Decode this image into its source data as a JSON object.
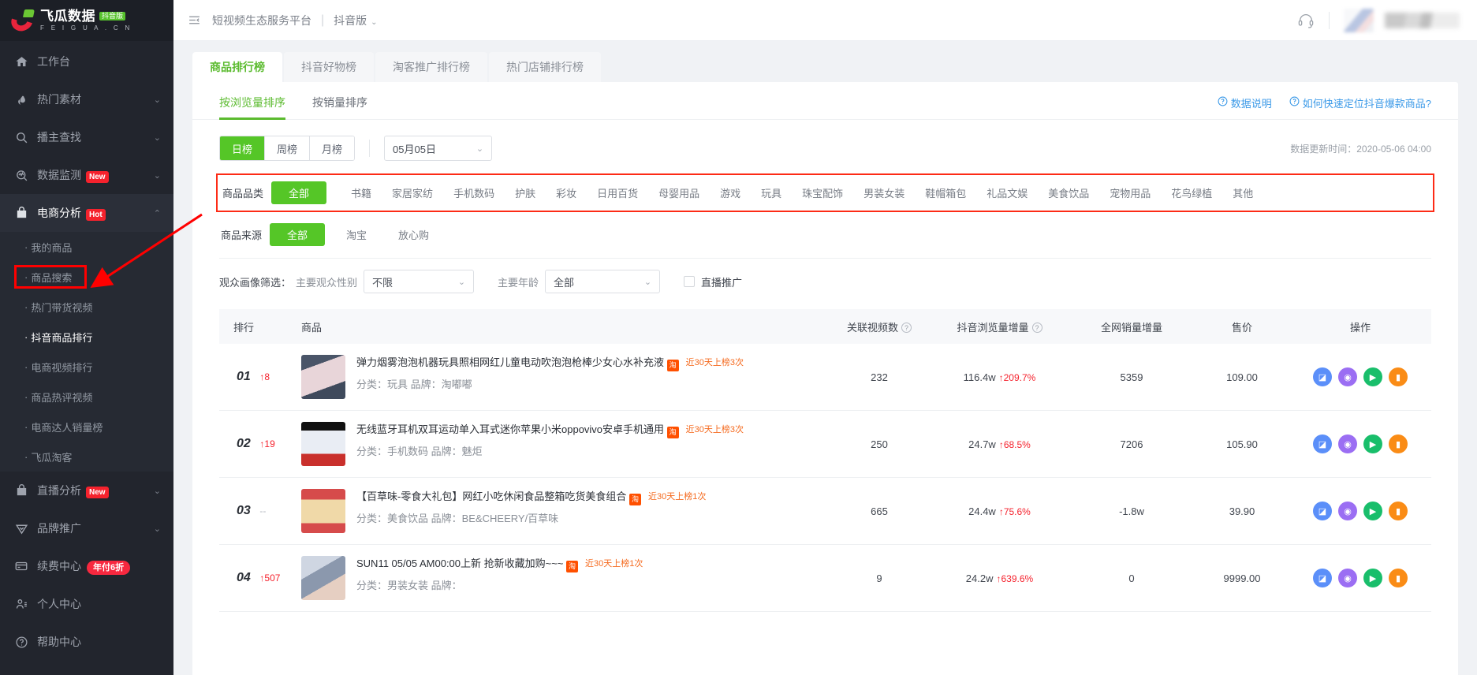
{
  "brand": {
    "name_cn": "飞瓜数据",
    "badge": "抖音版",
    "name_en": "F E I G U A . C N"
  },
  "sidebar": {
    "items": [
      {
        "label": "工作台",
        "icon": "home-icon",
        "chevron": "",
        "badge": ""
      },
      {
        "label": "热门素材",
        "icon": "fire-icon",
        "chevron": "⌄",
        "badge": ""
      },
      {
        "label": "播主查找",
        "icon": "search-icon",
        "chevron": "⌄",
        "badge": ""
      },
      {
        "label": "数据监测",
        "icon": "monitor-icon",
        "chevron": "⌄",
        "badge": "New"
      },
      {
        "label": "电商分析",
        "icon": "bag-icon",
        "chevron": "⌃",
        "badge": "Hot"
      }
    ],
    "submenu": [
      {
        "label": "我的商品"
      },
      {
        "label": "商品搜索"
      },
      {
        "label": "热门带货视频"
      },
      {
        "label": "抖音商品排行"
      },
      {
        "label": "电商视频排行"
      },
      {
        "label": "商品热评视频"
      },
      {
        "label": "电商达人销量榜"
      },
      {
        "label": "飞瓜淘客"
      }
    ],
    "items_bottom": [
      {
        "label": "直播分析",
        "icon": "bag-icon",
        "chevron": "⌄",
        "badge": "New"
      },
      {
        "label": "品牌推广",
        "icon": "diamond-icon",
        "chevron": "⌄",
        "badge": ""
      },
      {
        "label": "续费中心",
        "icon": "card-icon",
        "chevron": "",
        "badge": "年付6折"
      },
      {
        "label": "个人中心",
        "icon": "user-icon",
        "chevron": "",
        "badge": ""
      },
      {
        "label": "帮助中心",
        "icon": "question-icon",
        "chevron": "",
        "badge": ""
      }
    ]
  },
  "topbar": {
    "collapse_icon": "collapse-menu-icon",
    "title": "短视频生态服务平台",
    "separator": "|",
    "version": "抖音版",
    "chevron": "⌄",
    "support_icon": "headset-icon"
  },
  "tabs": [
    {
      "label": "商品排行榜",
      "active": true
    },
    {
      "label": "抖音好物榜",
      "active": false
    },
    {
      "label": "淘客推广排行榜",
      "active": false
    },
    {
      "label": "热门店铺排行榜",
      "active": false
    }
  ],
  "subtabs": [
    {
      "label": "按浏览量排序",
      "active": true
    },
    {
      "label": "按销量排序",
      "active": false
    }
  ],
  "help_links": [
    {
      "label": "数据说明",
      "icon": "question-circle-icon"
    },
    {
      "label": "如何快速定位抖音爆款商品?",
      "icon": "question-circle-icon"
    }
  ],
  "period": {
    "options": [
      {
        "label": "日榜",
        "active": true
      },
      {
        "label": "周榜",
        "active": false
      },
      {
        "label": "月榜",
        "active": false
      }
    ],
    "date_value": "05月05日",
    "date_chevron": "⌄"
  },
  "update_time": "数据更新时间：2020-05-06 04:00",
  "category_filter": {
    "label": "商品品类",
    "chips": [
      {
        "label": "全部",
        "active": true
      },
      {
        "label": "书籍",
        "active": false
      },
      {
        "label": "家居家纺",
        "active": false
      },
      {
        "label": "手机数码",
        "active": false
      },
      {
        "label": "护肤",
        "active": false
      },
      {
        "label": "彩妆",
        "active": false
      },
      {
        "label": "日用百货",
        "active": false
      },
      {
        "label": "母婴用品",
        "active": false
      },
      {
        "label": "游戏",
        "active": false
      },
      {
        "label": "玩具",
        "active": false
      },
      {
        "label": "珠宝配饰",
        "active": false
      },
      {
        "label": "男装女装",
        "active": false
      },
      {
        "label": "鞋帽箱包",
        "active": false
      },
      {
        "label": "礼品文娱",
        "active": false
      },
      {
        "label": "美食饮品",
        "active": false
      },
      {
        "label": "宠物用品",
        "active": false
      },
      {
        "label": "花鸟绿植",
        "active": false
      },
      {
        "label": "其他",
        "active": false
      }
    ]
  },
  "source_filter": {
    "label": "商品来源",
    "chips": [
      {
        "label": "全部",
        "active": true
      },
      {
        "label": "淘宝",
        "active": false
      },
      {
        "label": "放心购",
        "active": false
      }
    ]
  },
  "audience_filter": {
    "label": "观众画像筛选：",
    "gender_label": "主要观众性别",
    "gender_value": "不限",
    "age_label": "主要年龄",
    "age_value": "全部",
    "chevron": "⌄",
    "checkbox_label": "直播推广",
    "checkbox_checked": false
  },
  "table": {
    "columns": [
      {
        "label": "排行",
        "help": false
      },
      {
        "label": "商品",
        "help": false
      },
      {
        "label": "关联视频数",
        "help": true
      },
      {
        "label": "抖音浏览量增量",
        "help": true
      },
      {
        "label": "全网销量增量",
        "help": false
      },
      {
        "label": "售价",
        "help": false
      },
      {
        "label": "操作",
        "help": false
      }
    ],
    "rows": [
      {
        "rank": "01",
        "rank_delta": "↑8",
        "rank_flat": false,
        "thumb": "t1",
        "title": "弹力烟雾泡泡机器玩具照相网红儿童电动吹泡泡枪棒少女心水补充液",
        "source_icon": "taobao-icon",
        "tag": "近30天上榜3次",
        "sub": "分类：玩具 品牌：淘嘟嘟",
        "videos": "232",
        "views": "116.4w",
        "views_pct": "↑209.7%",
        "sales": "5359",
        "price": "109.00",
        "ops": [
          "trend-icon",
          "user-icon",
          "play-icon",
          "cart-icon"
        ]
      },
      {
        "rank": "02",
        "rank_delta": "↑19",
        "rank_flat": false,
        "thumb": "t2",
        "title": "无线蓝牙耳机双耳运动单入耳式迷你苹果小米oppovivo安卓手机通用",
        "source_icon": "taobao-icon",
        "tag": "近30天上榜3次",
        "sub": "分类：手机数码 品牌：魅炬",
        "videos": "250",
        "views": "24.7w",
        "views_pct": "↑68.5%",
        "sales": "7206",
        "price": "105.90",
        "ops": [
          "trend-icon",
          "user-icon",
          "play-icon",
          "cart-icon"
        ]
      },
      {
        "rank": "03",
        "rank_delta": "--",
        "rank_flat": true,
        "thumb": "t3",
        "title": "【百草味-零食大礼包】网红小吃休闲食品整箱吃货美食组合",
        "source_icon": "taobao-icon",
        "tag": "近30天上榜1次",
        "sub": "分类：美食饮品 品牌：BE&CHEERY/百草味",
        "videos": "665",
        "views": "24.4w",
        "views_pct": "↑75.6%",
        "sales": "-1.8w",
        "price": "39.90",
        "ops": [
          "trend-icon",
          "user-icon",
          "play-icon",
          "cart-icon"
        ]
      },
      {
        "rank": "04",
        "rank_delta": "↑507",
        "rank_flat": false,
        "thumb": "t4",
        "title": "SUN11 05/05 AM00:00上新 抢新收藏加购~~~",
        "source_icon": "taobao-icon",
        "tag": "近30天上榜1次",
        "sub": "分类：男装女装 品牌：",
        "videos": "9",
        "views": "24.2w",
        "views_pct": "↑639.6%",
        "sales": "0",
        "price": "9999.00",
        "ops": [
          "trend-icon",
          "user-icon",
          "play-icon",
          "cart-icon"
        ]
      }
    ]
  },
  "colors": {
    "accent_green": "#55c627",
    "annotation_red": "#fd2b16",
    "link_blue": "#3c9ae8",
    "up_red": "#f5222d"
  }
}
